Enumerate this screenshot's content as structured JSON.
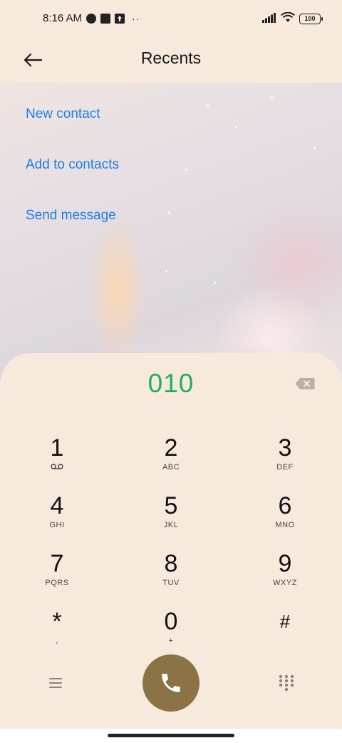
{
  "status_bar": {
    "time": "8:16 AM",
    "dots": "··",
    "battery": "100"
  },
  "header": {
    "title": "Recents",
    "back_icon": "arrow-left-icon"
  },
  "actions": {
    "new_contact": "New contact",
    "add_to_contacts": "Add to contacts",
    "send_message": "Send message"
  },
  "dialpad": {
    "number": "010",
    "keys": [
      {
        "digit": "1",
        "letters": ""
      },
      {
        "digit": "2",
        "letters": "ABC"
      },
      {
        "digit": "3",
        "letters": "DEF"
      },
      {
        "digit": "4",
        "letters": "GHI"
      },
      {
        "digit": "5",
        "letters": "JKL"
      },
      {
        "digit": "6",
        "letters": "MNO"
      },
      {
        "digit": "7",
        "letters": "PQRS"
      },
      {
        "digit": "8",
        "letters": "TUV"
      },
      {
        "digit": "9",
        "letters": "WXYZ"
      },
      {
        "digit": "*",
        "letters": ","
      },
      {
        "digit": "0",
        "letters": "+"
      },
      {
        "digit": "#",
        "letters": ""
      }
    ]
  },
  "colors": {
    "link": "#1e7fe0",
    "dialed": "#1db15a",
    "call_button": "#8b7345",
    "background": "#f7eadd"
  }
}
